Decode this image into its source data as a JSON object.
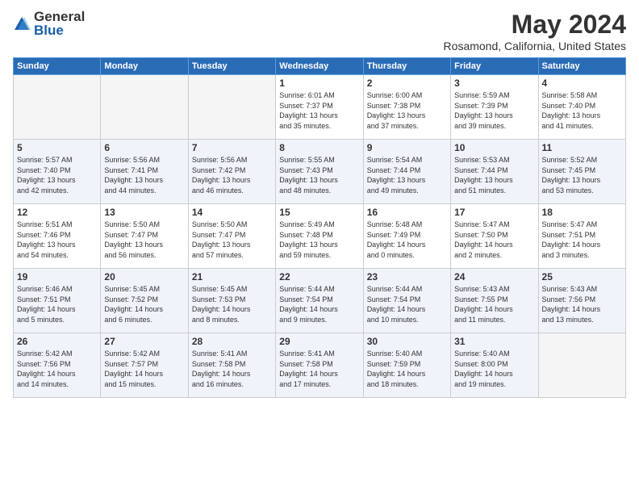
{
  "header": {
    "logo_general": "General",
    "logo_blue": "Blue",
    "month_title": "May 2024",
    "location": "Rosamond, California, United States"
  },
  "days_of_week": [
    "Sunday",
    "Monday",
    "Tuesday",
    "Wednesday",
    "Thursday",
    "Friday",
    "Saturday"
  ],
  "weeks": [
    [
      {
        "num": "",
        "info": ""
      },
      {
        "num": "",
        "info": ""
      },
      {
        "num": "",
        "info": ""
      },
      {
        "num": "1",
        "info": "Sunrise: 6:01 AM\nSunset: 7:37 PM\nDaylight: 13 hours\nand 35 minutes."
      },
      {
        "num": "2",
        "info": "Sunrise: 6:00 AM\nSunset: 7:38 PM\nDaylight: 13 hours\nand 37 minutes."
      },
      {
        "num": "3",
        "info": "Sunrise: 5:59 AM\nSunset: 7:39 PM\nDaylight: 13 hours\nand 39 minutes."
      },
      {
        "num": "4",
        "info": "Sunrise: 5:58 AM\nSunset: 7:40 PM\nDaylight: 13 hours\nand 41 minutes."
      }
    ],
    [
      {
        "num": "5",
        "info": "Sunrise: 5:57 AM\nSunset: 7:40 PM\nDaylight: 13 hours\nand 42 minutes."
      },
      {
        "num": "6",
        "info": "Sunrise: 5:56 AM\nSunset: 7:41 PM\nDaylight: 13 hours\nand 44 minutes."
      },
      {
        "num": "7",
        "info": "Sunrise: 5:56 AM\nSunset: 7:42 PM\nDaylight: 13 hours\nand 46 minutes."
      },
      {
        "num": "8",
        "info": "Sunrise: 5:55 AM\nSunset: 7:43 PM\nDaylight: 13 hours\nand 48 minutes."
      },
      {
        "num": "9",
        "info": "Sunrise: 5:54 AM\nSunset: 7:44 PM\nDaylight: 13 hours\nand 49 minutes."
      },
      {
        "num": "10",
        "info": "Sunrise: 5:53 AM\nSunset: 7:44 PM\nDaylight: 13 hours\nand 51 minutes."
      },
      {
        "num": "11",
        "info": "Sunrise: 5:52 AM\nSunset: 7:45 PM\nDaylight: 13 hours\nand 53 minutes."
      }
    ],
    [
      {
        "num": "12",
        "info": "Sunrise: 5:51 AM\nSunset: 7:46 PM\nDaylight: 13 hours\nand 54 minutes."
      },
      {
        "num": "13",
        "info": "Sunrise: 5:50 AM\nSunset: 7:47 PM\nDaylight: 13 hours\nand 56 minutes."
      },
      {
        "num": "14",
        "info": "Sunrise: 5:50 AM\nSunset: 7:47 PM\nDaylight: 13 hours\nand 57 minutes."
      },
      {
        "num": "15",
        "info": "Sunrise: 5:49 AM\nSunset: 7:48 PM\nDaylight: 13 hours\nand 59 minutes."
      },
      {
        "num": "16",
        "info": "Sunrise: 5:48 AM\nSunset: 7:49 PM\nDaylight: 14 hours\nand 0 minutes."
      },
      {
        "num": "17",
        "info": "Sunrise: 5:47 AM\nSunset: 7:50 PM\nDaylight: 14 hours\nand 2 minutes."
      },
      {
        "num": "18",
        "info": "Sunrise: 5:47 AM\nSunset: 7:51 PM\nDaylight: 14 hours\nand 3 minutes."
      }
    ],
    [
      {
        "num": "19",
        "info": "Sunrise: 5:46 AM\nSunset: 7:51 PM\nDaylight: 14 hours\nand 5 minutes."
      },
      {
        "num": "20",
        "info": "Sunrise: 5:45 AM\nSunset: 7:52 PM\nDaylight: 14 hours\nand 6 minutes."
      },
      {
        "num": "21",
        "info": "Sunrise: 5:45 AM\nSunset: 7:53 PM\nDaylight: 14 hours\nand 8 minutes."
      },
      {
        "num": "22",
        "info": "Sunrise: 5:44 AM\nSunset: 7:54 PM\nDaylight: 14 hours\nand 9 minutes."
      },
      {
        "num": "23",
        "info": "Sunrise: 5:44 AM\nSunset: 7:54 PM\nDaylight: 14 hours\nand 10 minutes."
      },
      {
        "num": "24",
        "info": "Sunrise: 5:43 AM\nSunset: 7:55 PM\nDaylight: 14 hours\nand 11 minutes."
      },
      {
        "num": "25",
        "info": "Sunrise: 5:43 AM\nSunset: 7:56 PM\nDaylight: 14 hours\nand 13 minutes."
      }
    ],
    [
      {
        "num": "26",
        "info": "Sunrise: 5:42 AM\nSunset: 7:56 PM\nDaylight: 14 hours\nand 14 minutes."
      },
      {
        "num": "27",
        "info": "Sunrise: 5:42 AM\nSunset: 7:57 PM\nDaylight: 14 hours\nand 15 minutes."
      },
      {
        "num": "28",
        "info": "Sunrise: 5:41 AM\nSunset: 7:58 PM\nDaylight: 14 hours\nand 16 minutes."
      },
      {
        "num": "29",
        "info": "Sunrise: 5:41 AM\nSunset: 7:58 PM\nDaylight: 14 hours\nand 17 minutes."
      },
      {
        "num": "30",
        "info": "Sunrise: 5:40 AM\nSunset: 7:59 PM\nDaylight: 14 hours\nand 18 minutes."
      },
      {
        "num": "31",
        "info": "Sunrise: 5:40 AM\nSunset: 8:00 PM\nDaylight: 14 hours\nand 19 minutes."
      },
      {
        "num": "",
        "info": ""
      }
    ]
  ]
}
